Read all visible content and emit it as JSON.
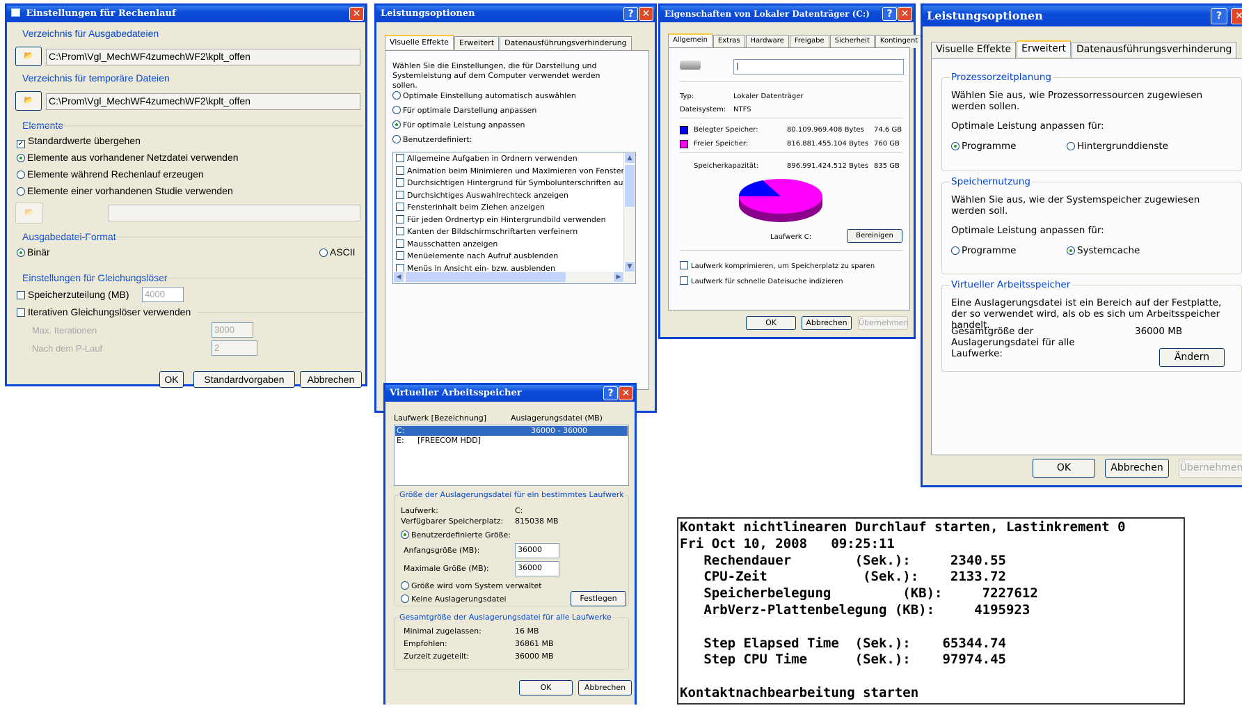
{
  "win1": {
    "title": "Einstellungen für Rechenlauf",
    "out_dir_label": "Verzeichnis für Ausgabedateien",
    "out_dir_value": "C:\\Prom\\Vgl_MechWF4zumechWF2\\kplt_offen",
    "tmp_dir_label": "Verzeichnis für temporäre Dateien",
    "tmp_dir_value": "C:\\Prom\\Vgl_MechWF4zumechWF2\\kplt_offen",
    "elements_label": "Elemente",
    "opt_standard": "Standardwerte übergehen",
    "opt_netz": "Elemente aus vorhandener Netzdatei verwenden",
    "opt_rechen": "Elemente während Rechenlauf erzeugen",
    "opt_studie": "Elemente einer vorhandenen Studie verwenden",
    "format_label": "Ausgabedatei-Format",
    "format_binary": "Binär",
    "format_ascii": "ASCII",
    "solver_label": "Einstellungen für Gleichungslöser",
    "mem_label": "Speicherzuteilung (MB)",
    "mem_value": "4000",
    "iter_label": "Iterativen Gleichungslöser verwenden",
    "max_iter_label": "Max. Iterationen",
    "max_iter_value": "3000",
    "plauf_label": "Nach dem P-Lauf",
    "plauf_value": "2",
    "ok": "OK",
    "defaults": "Standardvorgaben",
    "cancel": "Abbrechen"
  },
  "win2": {
    "title": "Leistungsoptionen",
    "tabs": [
      "Visuelle Effekte",
      "Erweitert",
      "Datenausführungsverhinderung"
    ],
    "intro": "Wählen Sie die Einstellungen, die für Darstellung und Systemleistung auf dem Computer verwendet werden sollen.",
    "radios": [
      "Optimale Einstellung automatisch auswählen",
      "Für optimale Darstellung anpassen",
      "Für optimale Leistung anpassen",
      "Benutzerdefiniert:"
    ],
    "list": [
      "Allgemeine Aufgaben in Ordnern verwenden",
      "Animation beim Minimieren und Maximieren von Fenstern",
      "Durchsichtigen Hintergrund für Symbolunterschriften auf d",
      "Durchsichtiges Auswahlrechteck anzeigen",
      "Fensterinhalt beim Ziehen anzeigen",
      "Für jeden Ordnertyp ein Hintergrundbild verwenden",
      "Kanten der Bildschirmschriftarten verfeinern",
      "Mausschatten anzeigen",
      "Menüelemente nach Aufruf ausblenden",
      "Menüs in Ansicht ein- bzw. ausblenden"
    ]
  },
  "win3": {
    "title": "Eigenschaften von Lokaler Datenträger (C:)",
    "tabs": [
      "Allgemein",
      "Extras",
      "Hardware",
      "Freigabe",
      "Sicherheit",
      "Kontingent"
    ],
    "type_label": "Typ:",
    "type_value": "Lokaler Datenträger",
    "fs_label": "Dateisystem:",
    "fs_value": "NTFS",
    "used_label": "Belegter Speicher:",
    "used_bytes": "80.109.969.408 Bytes",
    "used_gb": "74,6 GB",
    "free_label": "Freier Speicher:",
    "free_bytes": "816.881.455.104 Bytes",
    "free_gb": "760 GB",
    "cap_label": "Speicherkapazität:",
    "cap_bytes": "896.991.424.512 Bytes",
    "cap_gb": "835 GB",
    "drive_label": "Laufwerk C:",
    "cleanup": "Bereinigen",
    "compress": "Laufwerk komprimieren, um Speicherplatz zu sparen",
    "index": "Laufwerk für schnelle Dateisuche indizieren",
    "ok": "OK",
    "cancel": "Abbrechen",
    "apply": "Übernehmen",
    "used_color": "#0000ff",
    "free_color": "#ff00ff"
  },
  "win4": {
    "title": "Leistungsoptionen",
    "tabs": [
      "Visuelle Effekte",
      "Erweitert",
      "Datenausführungsverhinderung"
    ],
    "proc_title": "Prozessorzeitplanung",
    "proc_text": "Wählen Sie aus, wie Prozessorressourcen zugewiesen werden sollen.",
    "opt_label": "Optimale Leistung anpassen für:",
    "programs": "Programme",
    "background": "Hintergrunddienste",
    "mem_title": "Speichernutzung",
    "mem_text": "Wählen Sie aus, wie der Systemspeicher zugewiesen werden soll.",
    "syscache": "Systemcache",
    "vm_title": "Virtueller Arbeitsspeicher",
    "vm_text": "Eine Auslagerungsdatei ist ein Bereich auf der Festplatte, der so verwendet wird, als ob es sich um Arbeitsspeicher handelt.",
    "vm_total_label": "Gesamtgröße der Auslagerungsdatei für alle Laufwerke:",
    "vm_total_value": "36000 MB",
    "change": "Ändern",
    "ok": "OK",
    "cancel": "Abbrechen",
    "apply": "Übernehmen"
  },
  "win5": {
    "title": "Virtueller Arbeitsspeicher",
    "col_drive": "Laufwerk [Bezeichnung]",
    "col_pagefile": "Auslagerungsdatei (MB)",
    "row1_drive": "C:",
    "row1_value": "36000 - 36000",
    "row2_drive": "E:",
    "row2_label": "[FREECOM HDD]",
    "group1": "Größe der Auslagerungsdatei für ein bestimmtes Laufwerk",
    "drive_label": "Laufwerk:",
    "drive_value": "C:",
    "avail_label": "Verfügbarer Speicherplatz:",
    "avail_value": "815038 MB",
    "custom": "Benutzerdefinierte Größe:",
    "init_label": "Anfangsgröße (MB):",
    "init_value": "36000",
    "max_label": "Maximale Größe (MB):",
    "max_value": "36000",
    "system": "Größe wird vom System verwaltet",
    "none": "Keine Auslagerungsdatei",
    "set": "Festlegen",
    "group2": "Gesamtgröße der Auslagerungsdatei für alle Laufwerke",
    "min_label": "Minimal zugelassen:",
    "min_value": "16 MB",
    "rec_label": "Empfohlen:",
    "rec_value": "36861 MB",
    "cur_label": "Zurzeit zugeteilt:",
    "cur_value": "36000 MB",
    "ok": "OK",
    "cancel": "Abbrechen"
  },
  "console": {
    "lines": [
      "Kontakt nichtlinearen Durchlauf starten, Lastinkrement 0",
      "Fri Oct 10, 2008   09:25:11",
      "   Rechendauer        (Sek.):     2340.55",
      "   CPU-Zeit            (Sek.):    2133.72",
      "   Speicherbelegung         (KB):     7227612",
      "   ArbVerz-Plattenbelegung (KB):     4195923",
      "",
      "   Step Elapsed Time  (Sek.):    65344.74",
      "   Step CPU Time      (Sek.):    97974.45",
      "",
      "Kontaktnachbearbeitung starten"
    ]
  }
}
